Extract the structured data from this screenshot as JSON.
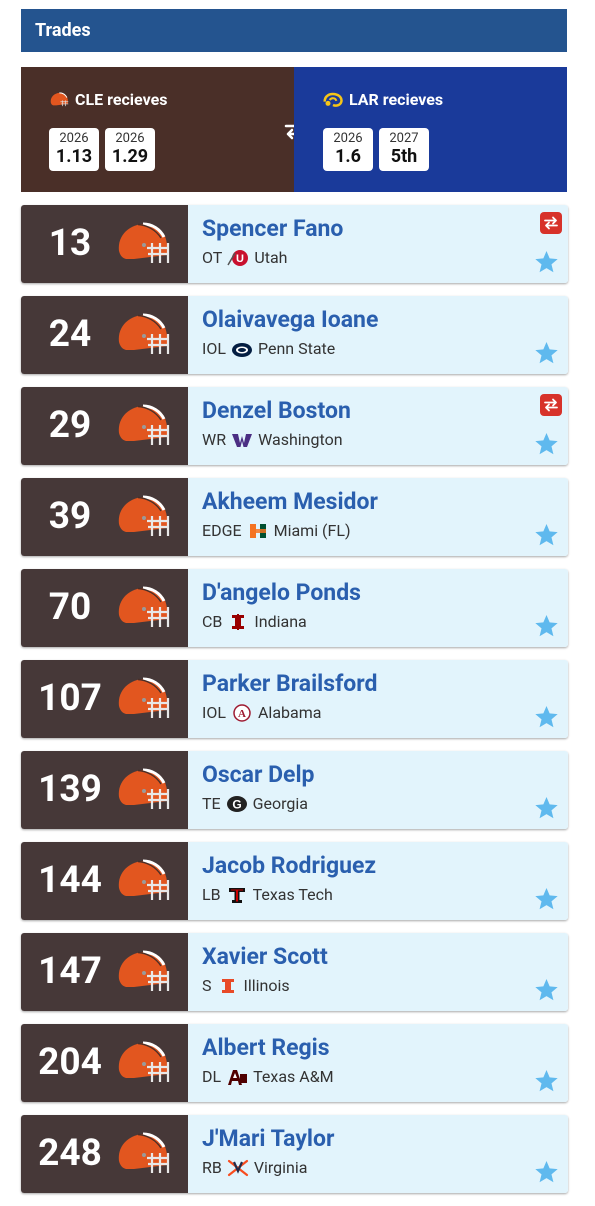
{
  "header": {
    "title": "Trades"
  },
  "trade": {
    "left": {
      "team": "CLE recieves",
      "picks": [
        {
          "year": "2026",
          "pick": "1.13"
        },
        {
          "year": "2026",
          "pick": "1.29"
        }
      ]
    },
    "right": {
      "team": "LAR recieves",
      "picks": [
        {
          "year": "2026",
          "pick": "1.6"
        },
        {
          "year": "2027",
          "pick": "5th"
        }
      ]
    },
    "swap_icon": "swap-arrows-icon"
  },
  "picks": [
    {
      "pick": "13",
      "name": "Spencer Fano",
      "pos": "OT",
      "school": "Utah",
      "traded": true,
      "school_icon": "utah-logo-icon"
    },
    {
      "pick": "24",
      "name": "Olaivavega Ioane",
      "pos": "IOL",
      "school": "Penn State",
      "traded": false,
      "school_icon": "penn-state-logo-icon"
    },
    {
      "pick": "29",
      "name": "Denzel Boston",
      "pos": "WR",
      "school": "Washington",
      "traded": true,
      "school_icon": "washington-logo-icon"
    },
    {
      "pick": "39",
      "name": "Akheem Mesidor",
      "pos": "EDGE",
      "school": "Miami (FL)",
      "traded": false,
      "school_icon": "miami-logo-icon"
    },
    {
      "pick": "70",
      "name": "D'angelo Ponds",
      "pos": "CB",
      "school": "Indiana",
      "traded": false,
      "school_icon": "indiana-logo-icon"
    },
    {
      "pick": "107",
      "name": "Parker Brailsford",
      "pos": "IOL",
      "school": "Alabama",
      "traded": false,
      "school_icon": "alabama-logo-icon"
    },
    {
      "pick": "139",
      "name": "Oscar Delp",
      "pos": "TE",
      "school": "Georgia",
      "traded": false,
      "school_icon": "georgia-logo-icon"
    },
    {
      "pick": "144",
      "name": "Jacob Rodriguez",
      "pos": "LB",
      "school": "Texas Tech",
      "traded": false,
      "school_icon": "texas-tech-logo-icon"
    },
    {
      "pick": "147",
      "name": "Xavier Scott",
      "pos": "S",
      "school": "Illinois",
      "traded": false,
      "school_icon": "illinois-logo-icon"
    },
    {
      "pick": "204",
      "name": "Albert Regis",
      "pos": "DL",
      "school": "Texas A&M",
      "traded": false,
      "school_icon": "texas-am-logo-icon"
    },
    {
      "pick": "248",
      "name": "J'Mari Taylor",
      "pos": "RB",
      "school": "Virginia",
      "traded": false,
      "school_icon": "virginia-logo-icon"
    }
  ],
  "colors": {
    "header_bg": "#24548f",
    "cle_bg": "#4a2f28",
    "lar_bg": "#1a3a9a",
    "pick_bg": "#463838",
    "card_bg": "#e2f4fc",
    "name": "#2a5fae",
    "trade_badge": "#d7322a",
    "star": "#5fb9ee",
    "helmet": "#e2561f"
  }
}
